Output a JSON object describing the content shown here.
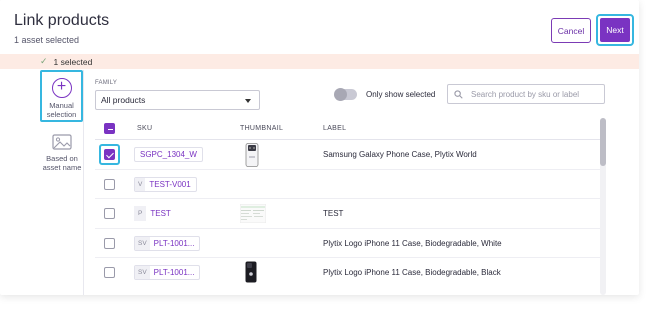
{
  "header": {
    "title": "Link products",
    "subtitle": "1 asset selected",
    "cancel_label": "Cancel",
    "next_label": "Next"
  },
  "banner": {
    "text": "1 selected"
  },
  "nav": {
    "manual_label": "Manual selection",
    "asset_label": "Based on asset name"
  },
  "filters": {
    "family_label": "FAMILY",
    "family_value": "All products",
    "toggle_label": "Only show selected",
    "toggle_on": false,
    "search_placeholder": "Search product by sku or label"
  },
  "table": {
    "columns": [
      "SKU",
      "THUMBNAIL",
      "LABEL"
    ],
    "rows": [
      {
        "checked": true,
        "type": "",
        "sku": "SGPC_1304_W",
        "thumbnail": "white-phone",
        "label": "Samsung Galaxy Phone Case, Plytix World"
      },
      {
        "checked": false,
        "type": "V",
        "sku": "TEST-V001",
        "thumbnail": "",
        "label": ""
      },
      {
        "checked": false,
        "type": "P",
        "sku": "TEST",
        "thumbnail": "spreadsheet",
        "label": "TEST"
      },
      {
        "checked": false,
        "type": "SV",
        "sku": "PLT-1001...",
        "thumbnail": "",
        "label": "Plytix Logo iPhone 11 Case, Biodegradable, White"
      },
      {
        "checked": false,
        "type": "SV",
        "sku": "PLT-1001...",
        "thumbnail": "black-phone",
        "label": "Plytix Logo iPhone 11 Case, Biodegradable, Black"
      }
    ]
  },
  "colors": {
    "accent": "#7a33c2",
    "highlight": "#36b7e0",
    "banner_bg": "#fdebe4"
  }
}
